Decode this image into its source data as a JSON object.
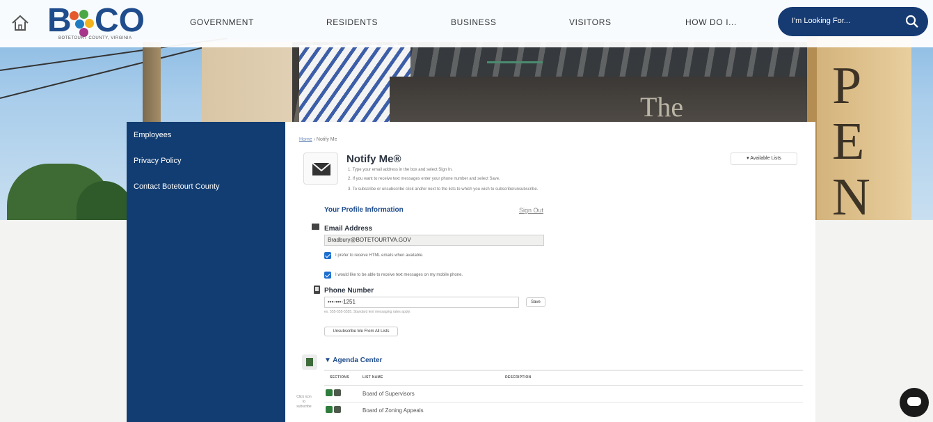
{
  "header": {
    "logo_text_b": "B",
    "logo_text_co": "CO",
    "logo_subtitle": "BOTETOURT COUNTY, VIRGINIA",
    "logo_dot_colors": [
      "#e55a2b",
      "#4aa845",
      "#1e7cc1",
      "#f2b31b",
      "#a8358b"
    ],
    "nav": [
      "GOVERNMENT",
      "RESIDENTS",
      "BUSINESS",
      "VISITORS",
      "HOW DO I..."
    ],
    "search_placeholder": "I'm Looking For..."
  },
  "hero": {
    "sign_letters": [
      "P",
      "E",
      "N"
    ],
    "storefront_text": "The"
  },
  "sidebar": {
    "items": [
      "Employees",
      "Privacy Policy",
      "Contact Botetourt County"
    ]
  },
  "main": {
    "breadcrumb_home": "Home",
    "breadcrumb_current": "Notify Me",
    "title": "Notify Me®",
    "instructions": [
      "1. Type your email address in the box and select Sign In.",
      "2. If you want to receive text messages enter your phone number and select Save.",
      "3. To subscribe or unsubscribe click  and/or  next to the lists to which you wish to subscribe/unsubscribe."
    ],
    "available_lists_button": "▾  Available Lists",
    "profile_heading": "Your Profile Information",
    "sign_out": "Sign Out",
    "email_label": "Email Address",
    "email_value": "Bradbury@BOTETOURTVA.GOV",
    "html_email_checkbox_label": "I prefer to receive HTML emails when available.",
    "text_checkbox_label": "I would like to be able to receive text messages on my mobile phone.",
    "phone_label": "Phone Number",
    "phone_value": "•••-•••-1251",
    "save_button": "Save",
    "phone_hint": "ex. 555-555-5555. Standard text messaging rates apply.",
    "unsubscribe_button": "Unsubscribe Me From All Lists",
    "agenda_heading": "▼ Agenda Center",
    "table_headers": [
      "SECTIONS",
      "LIST NAME",
      "DESCRIPTION"
    ],
    "rows": [
      "Board of Supervisors",
      "Board of Zoning Appeals"
    ],
    "click_hint": "Click icon to subscribe"
  },
  "colors": {
    "nav_blue": "#123d72",
    "search_blue": "#163b73",
    "heading_blue": "#1f4c8c",
    "checkbox_blue": "#1d6fd0"
  }
}
